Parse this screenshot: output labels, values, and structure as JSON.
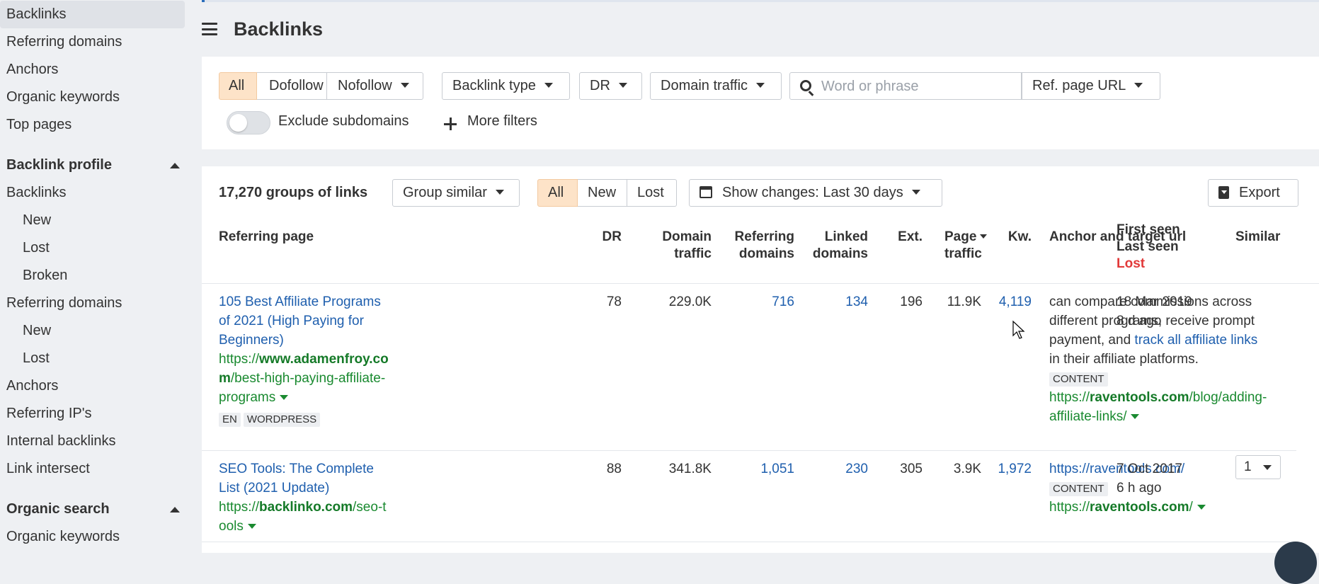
{
  "sidebar": {
    "top_items": [
      "Backlinks",
      "Referring domains",
      "Anchors",
      "Organic keywords",
      "Top pages"
    ],
    "backlink_profile": {
      "title": "Backlink profile",
      "backlinks": "Backlinks",
      "backlinks_sub": [
        "New",
        "Lost",
        "Broken"
      ],
      "referring_domains": "Referring domains",
      "referring_domains_sub": [
        "New",
        "Lost"
      ],
      "anchors": "Anchors",
      "referring_ips": "Referring IP's",
      "internal_backlinks": "Internal backlinks",
      "link_intersect": "Link intersect"
    },
    "organic_search": {
      "title": "Organic search",
      "organic_keywords": "Organic keywords"
    }
  },
  "header": {
    "title": "Backlinks"
  },
  "filters": {
    "all": "All",
    "dofollow": "Dofollow",
    "nofollow": "Nofollow",
    "backlink_type": "Backlink type",
    "dr": "DR",
    "domain_traffic": "Domain traffic",
    "search_placeholder": "Word or phrase",
    "ref_page_url": "Ref. page URL",
    "exclude_subdomains": "Exclude subdomains",
    "more_filters": "More filters"
  },
  "toolbar": {
    "groups_count": "17,270 groups of links",
    "group_similar": "Group similar",
    "all": "All",
    "new": "New",
    "lost": "Lost",
    "show_changes": "Show changes: Last 30 days",
    "export": "Export"
  },
  "columns": {
    "referring_page": "Referring page",
    "dr": "DR",
    "domain_traffic_1": "Domain",
    "domain_traffic_2": "traffic",
    "referring_domains_1": "Referring",
    "referring_domains_2": "domains",
    "linked_domains_1": "Linked",
    "linked_domains_2": "domains",
    "ext": "Ext.",
    "page_traffic_1": "Page",
    "page_traffic_2": "traffic",
    "kw": "Kw.",
    "anchor": "Anchor and target url",
    "first_seen": "First seen",
    "last_seen": "Last seen",
    "lost": "Lost",
    "similar": "Similar"
  },
  "rows": [
    {
      "title": "105 Best Affiliate Programs of 2021 (High Paying for Beginners)",
      "url_prefix": "https://",
      "url_domain": "www.adamenfroy.com",
      "url_path": "/best-high-paying-affiliate-programs",
      "tags": [
        "EN",
        "WORDPRESS"
      ],
      "dr": "78",
      "domain_traffic": "229.0K",
      "referring_domains": "716",
      "linked_domains": "134",
      "ext": "196",
      "page_traffic": "11.9K",
      "kw": "4,119",
      "anchor_text_before": "can compare commissions across different programs, receive prompt payment, and ",
      "anchor_link": "track all affiliate links",
      "anchor_text_after": " in their affiliate platforms.",
      "anchor_tag": "CONTENT",
      "target_prefix": "https://",
      "target_domain": "raventools.com",
      "target_path": "/blog/adding-affiliate-links/",
      "first_seen": "18 Mar 2019",
      "last_seen": "8 d ago"
    },
    {
      "title": "SEO Tools: The Complete List (2021 Update)",
      "url_prefix": "https://",
      "url_domain": "backlinko.com",
      "url_path": "/seo-tools",
      "dr": "88",
      "domain_traffic": "341.8K",
      "referring_domains": "1,051",
      "linked_domains": "230",
      "ext": "305",
      "page_traffic": "3.9K",
      "kw": "1,972",
      "anchor_url": "https://raventools.com/",
      "anchor_tag": "CONTENT",
      "target_prefix": "https://",
      "target_domain": "raventools.com",
      "target_path": "/",
      "first_seen": "7 Oct 2017",
      "last_seen": "6 h ago",
      "similar": "1"
    }
  ]
}
